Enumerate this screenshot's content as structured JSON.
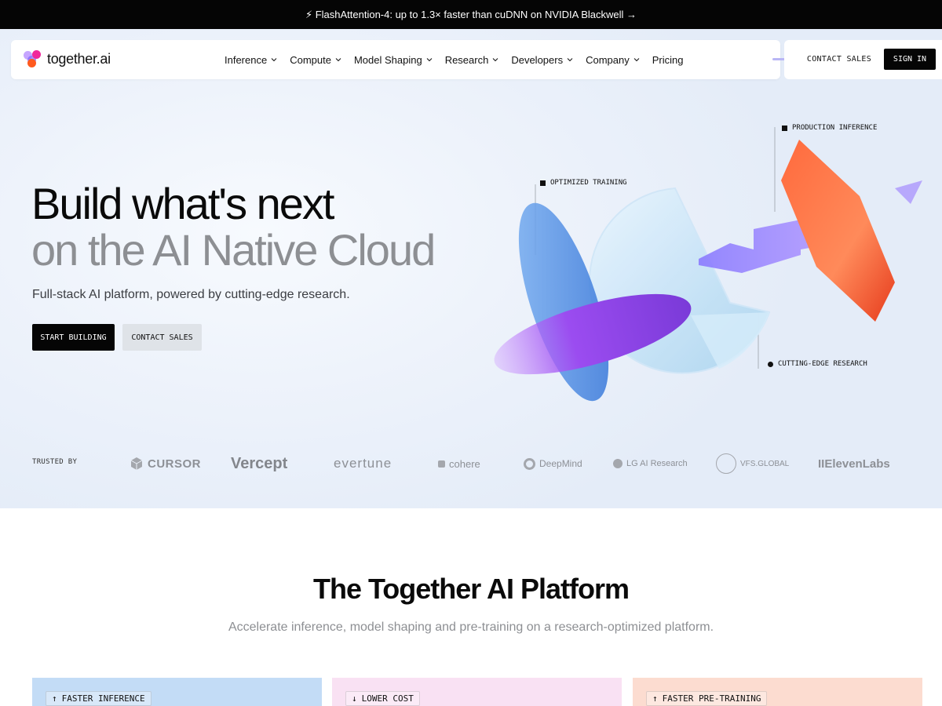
{
  "announcement": {
    "text": "⚡ FlashAttention-4: up to 1.3× faster than cuDNN on NVIDIA Blackwell →"
  },
  "brand": {
    "logo_text": "together.ai",
    "logo_colors": [
      "#c6a5ff",
      "#f0269a",
      "#ff5a1f",
      "#7b61ff"
    ]
  },
  "nav": {
    "items": [
      {
        "label": "Inference",
        "has_dropdown": true
      },
      {
        "label": "Compute",
        "has_dropdown": true
      },
      {
        "label": "Model Shaping",
        "has_dropdown": true
      },
      {
        "label": "Research",
        "has_dropdown": true
      },
      {
        "label": "Developers",
        "has_dropdown": true
      },
      {
        "label": "Company",
        "has_dropdown": true
      },
      {
        "label": "Pricing",
        "has_dropdown": false
      }
    ],
    "contact_label": "CONTACT SALES",
    "signin_label": "SIGN IN"
  },
  "hero": {
    "title_line1": "Build what's next",
    "title_line2": "on the AI Native Cloud",
    "subtitle": "Full-stack AI platform, powered by cutting-edge research.",
    "cta_primary": "START BUILDING",
    "cta_secondary": "CONTACT SALES",
    "callouts": {
      "production": "PRODUCTION INFERENCE",
      "training": "OPTIMIZED TRAINING",
      "research": "CUTTING-EDGE RESEARCH"
    }
  },
  "trusted": {
    "label": "TRUSTED BY",
    "logos": [
      "CURSOR",
      "Vercept",
      "evertune",
      "cohere",
      "DeepMind",
      "LG AI Research",
      "VFS.GLOBAL",
      "IIElevenLabs"
    ]
  },
  "platform": {
    "title": "The Together AI Platform",
    "subtitle": "Accelerate inference, model shaping and pre-training on a research-optimized platform.",
    "cards": [
      {
        "tag": "FASTER INFERENCE",
        "arrow": "↑",
        "color": "#c3dcf6"
      },
      {
        "tag": "LOWER COST",
        "arrow": "↓",
        "color": "#f9e1f3"
      },
      {
        "tag": "FASTER PRE-TRAINING",
        "arrow": "↑",
        "color": "#fcdcd0"
      }
    ]
  }
}
